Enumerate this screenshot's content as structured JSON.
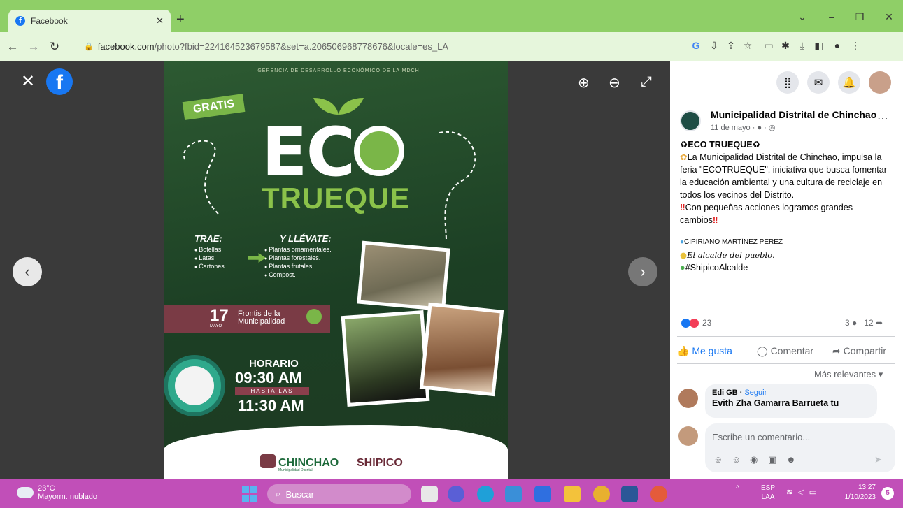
{
  "browser": {
    "tab_title": "Facebook",
    "url_host": "facebook.com",
    "url_rest": "/photo?fbid=224164523679587&set=a.206506968778676&locale=es_LA",
    "new_tab_symbol": "+",
    "accent_color": "#8fcf67"
  },
  "viewer": {
    "close_symbol": "✕",
    "logo_letter": "f",
    "zoom_in_symbol": "⊕",
    "zoom_out_symbol": "⊖",
    "fullscreen_symbol": "⤢",
    "prev_symbol": "‹",
    "next_symbol": "›"
  },
  "poster": {
    "header": "GERENCIA DE DESARROLLO ECONÓMICO DE LA MDCH",
    "gratis": "GRATIS",
    "eco": "EC",
    "trueque": "TRUEQUE",
    "trae_title": "TRAE:",
    "trae_items": [
      "Botellas.",
      "Latas.",
      "Cartones"
    ],
    "llevate_title": "Y LLÉVATE:",
    "llevate_items": [
      "Plantas ornamentales.",
      "Plantas forestales.",
      "Plantas frutales.",
      "Compost."
    ],
    "date_day": "17",
    "date_month": "MAYO",
    "place": "Frontis de la Municipalidad",
    "horario": "HORARIO",
    "time_start": "09:30 AM",
    "hasta": "HASTA LAS",
    "time_end": "11:30 AM",
    "logo1": "CHINCHAO",
    "logo1_sub": "Municipalidad Distrital",
    "logo2": "SHIPICO"
  },
  "post": {
    "page_name": "Municipalidad Distrital de Chinchao",
    "meta": "11 de mayo · ● · ◎",
    "title": "♻ECO TRUEQUE♻",
    "body1": "La Municipalidad Distrital de Chinchao, impulsa la feria \"ECOTRUEQUE\", iniciativa que busca fomentar la educación ambiental y una cultura de reciclaje en todos los vecinos del Distrito.",
    "body2": "Con pequeñas acciones logramos grandes cambios",
    "mark": "‼",
    "sig_name": "CIPIRIANO MARTÍNEZ PEREZ",
    "sig_tag": "El alcalde del pueblo.",
    "hashtag": "#ShipicoAlcalde",
    "reaction_count": "23",
    "comments_count": "3",
    "shares_count": "12",
    "like_label": "Me gusta",
    "comment_label": "Comentar",
    "share_label": "Compartir",
    "sort_label": "Más relevantes",
    "commenter": "Edi GB",
    "follow": "Seguir",
    "comment_text": "Evith Zha Gamarra Barrueta tu",
    "comment_placeholder": "Escribe un comentario..."
  },
  "taskbar": {
    "temp": "23°C",
    "weather": "Mayorm. nublado",
    "search": "Buscar",
    "lang1": "ESP",
    "lang2": "LAA",
    "time": "13:27",
    "date": "1/10/2023",
    "notif": "5"
  }
}
